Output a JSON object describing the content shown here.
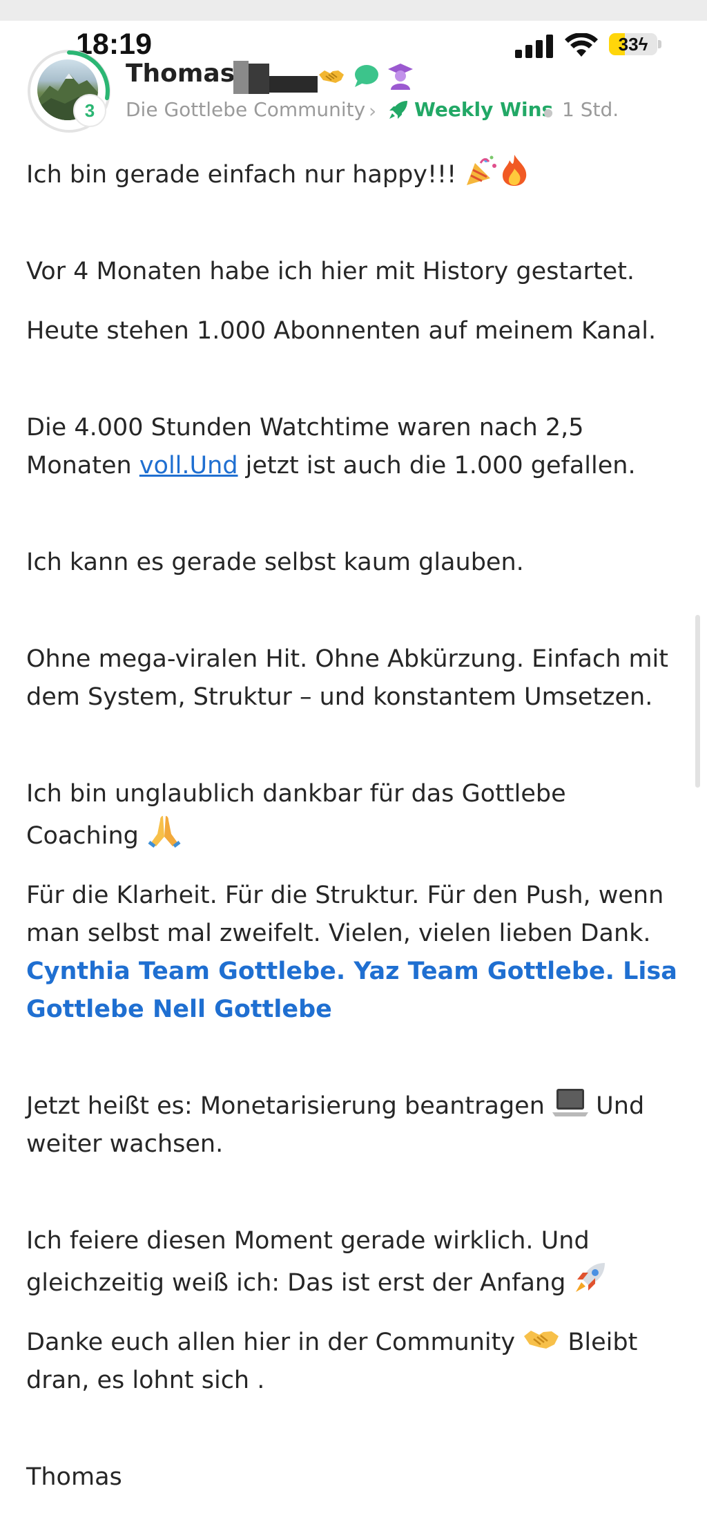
{
  "status_bar": {
    "time": "18:19",
    "battery": "33",
    "battery_level": 0.33
  },
  "author": {
    "name": "Thomas",
    "level": "3",
    "badges": [
      "handshake-icon",
      "chat-bubble-icon",
      "graduate-icon"
    ]
  },
  "meta": {
    "community": "Die Gottlebe Community",
    "space": "Weekly Wins",
    "time_ago": "1 Std."
  },
  "post": {
    "p1": "Ich bin gerade einfach nur happy!!!",
    "p2": "Vor 4 Monaten habe ich hier mit History gestartet.",
    "p3": "Heute stehen 1.000 Abonnenten auf meinem Kanal.",
    "p4a": "Die 4.000 Stunden Watchtime waren nach 2,5 Monaten ",
    "p4link": "voll.Und",
    "p4b": " jetzt ist auch die 1.000 gefallen.",
    "p5": "Ich kann es gerade selbst kaum glauben.",
    "p6": "Ohne mega-viralen Hit. Ohne Abkürzung. Einfach mit dem System, Struktur – und konstantem Umsetzen.",
    "p7": "Ich bin unglaublich dankbar für das Gottlebe Coaching",
    "p8": "Für die Klarheit. Für die Struktur. Für den Push, wenn man selbst mal zweifelt. Vielen, vielen lieben Dank.",
    "mentions": "Cynthia Team Gottlebe. Yaz Team Gottlebe. Lisa Gottlebe Nell Gottlebe",
    "p9a": "Jetzt heißt es: Monetarisierung beantragen",
    "p9b": " Und weiter wachsen.",
    "p10": "Ich feiere diesen Moment gerade wirklich. Und gleichzeitig weiß ich: Das ist erst der Anfang",
    "p11a": "Danke euch allen hier in der Community",
    "p11b": " Bleibt dran, es lohnt sich .",
    "signature": "Thomas"
  },
  "colors": {
    "accent_green": "#22a866",
    "link_blue": "#1f6fd1",
    "text": "#262626",
    "muted": "#9a9a9a"
  }
}
